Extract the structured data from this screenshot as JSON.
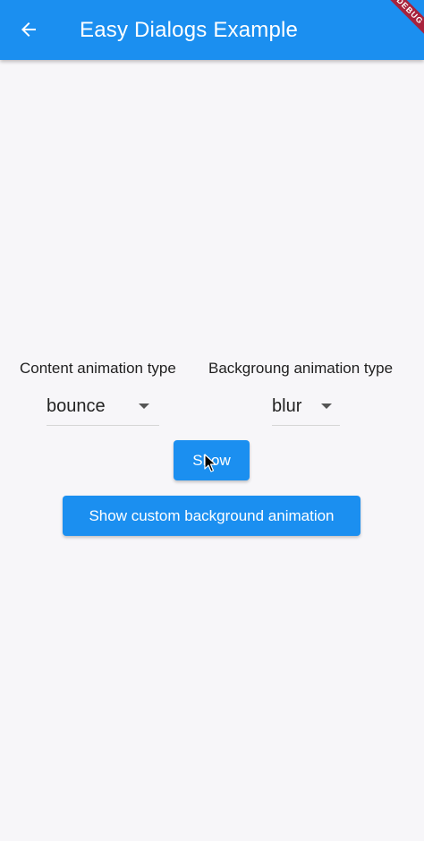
{
  "app_bar": {
    "title": "Easy Dialogs Example",
    "back_icon": "arrow-back-icon",
    "background_color": "#1b8ff0",
    "debug_banner": "DEBUG"
  },
  "controls": {
    "content_animation": {
      "label": "Content animation type",
      "selected": "bounce"
    },
    "background_animation": {
      "label": "Backgroung animation type",
      "selected": "blur"
    }
  },
  "buttons": {
    "show_label": "Show",
    "custom_label": "Show custom background animation",
    "accent_color": "#1b8ff0"
  }
}
